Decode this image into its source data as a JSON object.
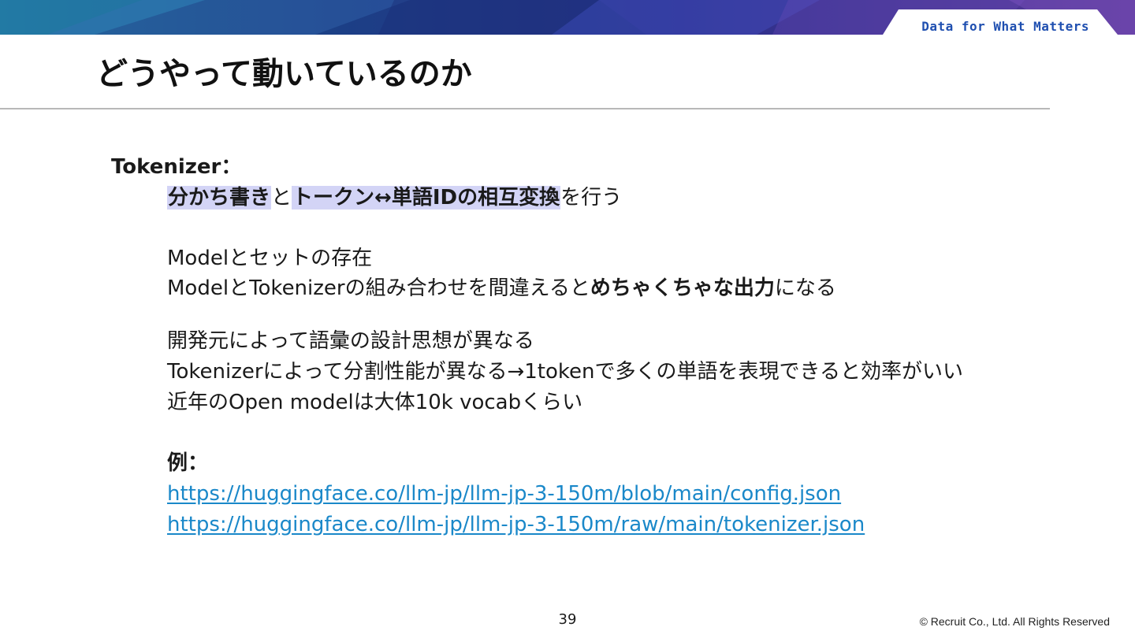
{
  "header": {
    "tagline": "Data for What Matters",
    "title": "どうやって動いているのか"
  },
  "body": {
    "tokenizer_label": "Tokenizer：",
    "line1": {
      "seg1": "分かち書き",
      "seg2": "と",
      "seg3": "トークン↔単語IDの相互変換",
      "seg4": "を行う"
    },
    "line2": "Modelとセットの存在",
    "line3": {
      "seg1": "ModelとTokenizerの組み合わせを間違えると",
      "seg2": "めちゃくちゃな出力",
      "seg3": "になる"
    },
    "line4": "開発元によって語彙の設計思想が異なる",
    "line5": "Tokenizerによって分割性能が異なる→1tokenで多くの単語を表現できると効率がいい",
    "line6": "近年のOpen modelは大体10k vocabくらい",
    "example_label": "例：",
    "links": [
      "https://huggingface.co/llm-jp/llm-jp-3-150m/blob/main/config.json",
      "https://huggingface.co/llm-jp/llm-jp-3-150m/raw/main/tokenizer.json"
    ]
  },
  "footer": {
    "page_number": "39",
    "copyright": "© Recruit Co., Ltd. All Rights Reserved"
  },
  "colors": {
    "highlight": "#d3d4f6",
    "link": "#1a88c9",
    "tagline": "#1f4fb0"
  }
}
